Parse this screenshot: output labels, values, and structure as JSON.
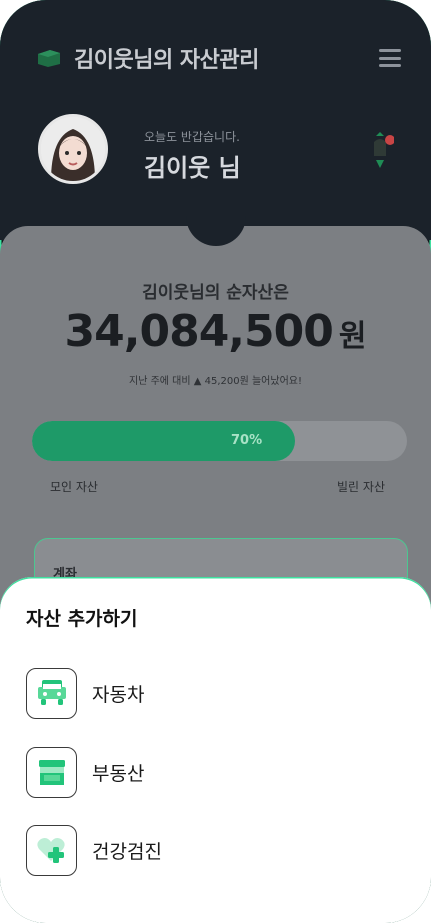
{
  "header": {
    "title": "김이웃님의 자산관리",
    "greeting": "오늘도 반갑습니다.",
    "user_name": "김이웃 님"
  },
  "net_worth": {
    "label": "김이웃님의 순자산은",
    "amount": "34,084,500",
    "unit": "원",
    "change_text": "지난 주에 대비 ▲ 45,200원 늘어났어요!"
  },
  "asset_ratio": {
    "percent": 70,
    "percent_label": "70%",
    "left_label": "모인 자산",
    "right_label": "빌린 자산"
  },
  "account_card": {
    "title": "계좌"
  },
  "sheet": {
    "title": "자산 추가하기",
    "items": [
      {
        "label": "자동차",
        "icon": "car-icon"
      },
      {
        "label": "부동산",
        "icon": "store-icon"
      },
      {
        "label": "건강검진",
        "icon": "health-heart-icon"
      }
    ]
  },
  "colors": {
    "accent": "#22c47a",
    "accent_light": "#58d898",
    "header_bg": "#1b222a",
    "overlay": "#7c7f83"
  }
}
